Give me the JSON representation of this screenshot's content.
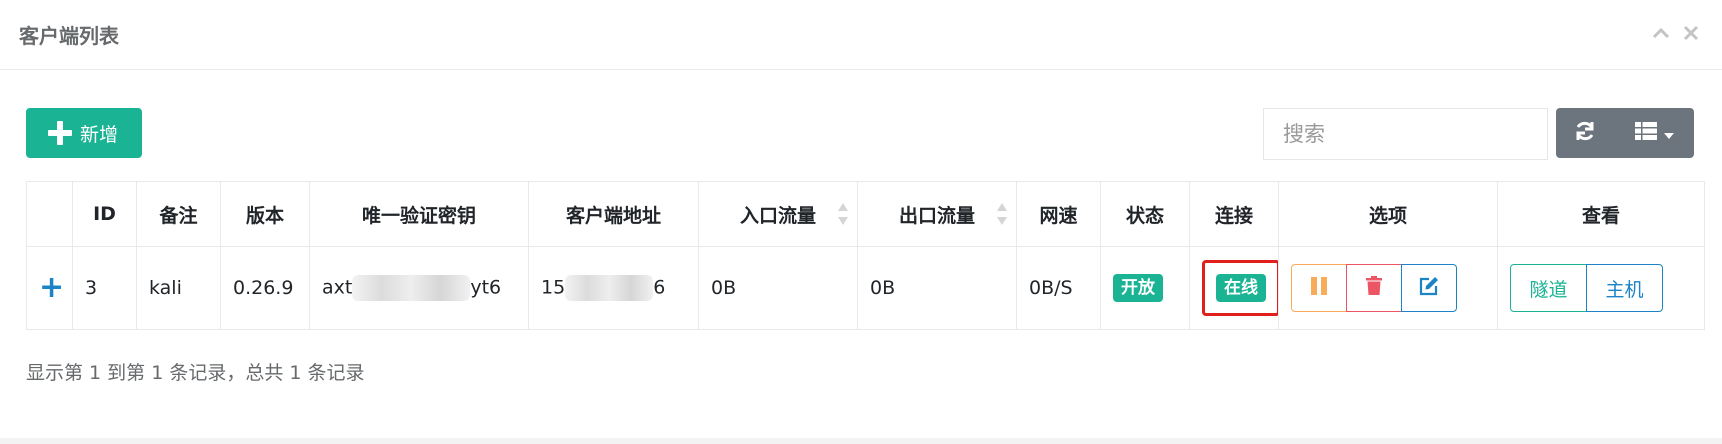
{
  "panel": {
    "title": "客户端列表",
    "tools": [
      "chevron-up-icon",
      "close-icon"
    ]
  },
  "toolbar": {
    "add_label": "新增",
    "search_placeholder": "搜索",
    "refresh_icon": "refresh-icon",
    "columns_icon": "columns-icon"
  },
  "colors": {
    "primary": "#1ab394",
    "warning": "#f8ac59",
    "danger": "#ed5565",
    "info": "#1c84c6",
    "secondary": "#6c757d",
    "highlight": "#e0201c"
  },
  "table": {
    "headers": [
      "",
      "ID",
      "备注",
      "版本",
      "唯一验证密钥",
      "客户端地址",
      "入口流量",
      "出口流量",
      "网速",
      "状态",
      "连接",
      "选项",
      "查看"
    ],
    "rows": [
      {
        "expand": "+",
        "id": "3",
        "remark": "kali",
        "version": "0.26.9",
        "key_prefix": "axt",
        "key_suffix": "yt6",
        "addr_prefix": "15",
        "addr_suffix": "6",
        "in_flow": "0B",
        "out_flow": "0B",
        "speed": "0B/S",
        "status": "开放",
        "connection": "在线",
        "view_tunnel": "隧道",
        "view_host": "主机"
      }
    ]
  },
  "pagination": {
    "info": "显示第 1 到第 1 条记录，总共 1 条记录"
  }
}
